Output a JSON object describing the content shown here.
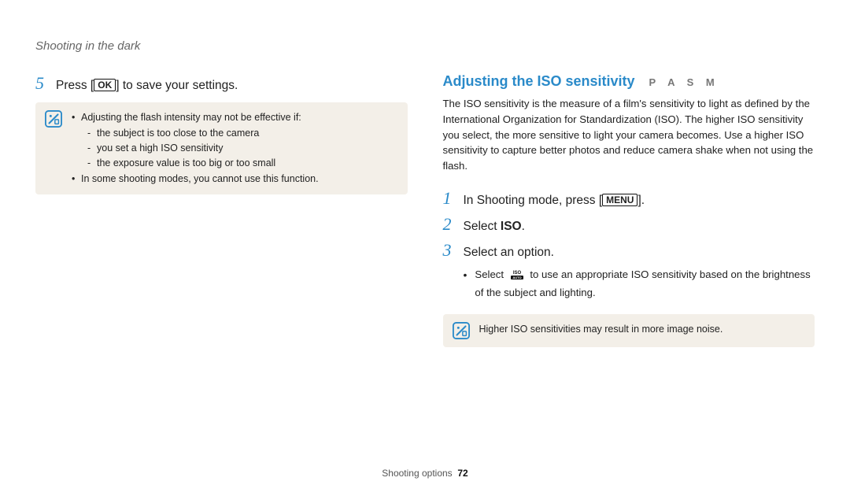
{
  "breadcrumb": "Shooting in the dark",
  "left": {
    "step5": {
      "num": "5",
      "pre": "Press [",
      "button": "OK",
      "post": "] to save your settings."
    },
    "note": {
      "line1": "Adjusting the flash intensity may not be effective if:",
      "sub1": "the subject is too close to the camera",
      "sub2": "you set a high ISO sensitivity",
      "sub3": "the exposure value is too big or too small",
      "line2": "In some shooting modes, you cannot use this function."
    }
  },
  "right": {
    "title": "Adjusting the ISO sensitivity",
    "modes": "P A S M",
    "intro": "The ISO sensitivity is the measure of a film's sensitivity to light as defined by the International Organization for Standardization (ISO). The higher ISO sensitivity you select, the more sensitive to light your camera becomes. Use a higher ISO sensitivity to capture better photos and reduce camera shake when not using the flash.",
    "step1": {
      "num": "1",
      "pre": "In Shooting mode, press [",
      "button": "MENU",
      "post": "]."
    },
    "step2": {
      "num": "2",
      "pre": "Select ",
      "bold": "ISO",
      "post": "."
    },
    "step3": {
      "num": "3",
      "text": "Select an option."
    },
    "sub_pre": "Select ",
    "sub_post": " to use an appropriate ISO sensitivity based on the brightness of the subject and lighting.",
    "note": "Higher ISO sensitivities may result in more image noise."
  },
  "footer": {
    "section": "Shooting options",
    "page": "72"
  }
}
